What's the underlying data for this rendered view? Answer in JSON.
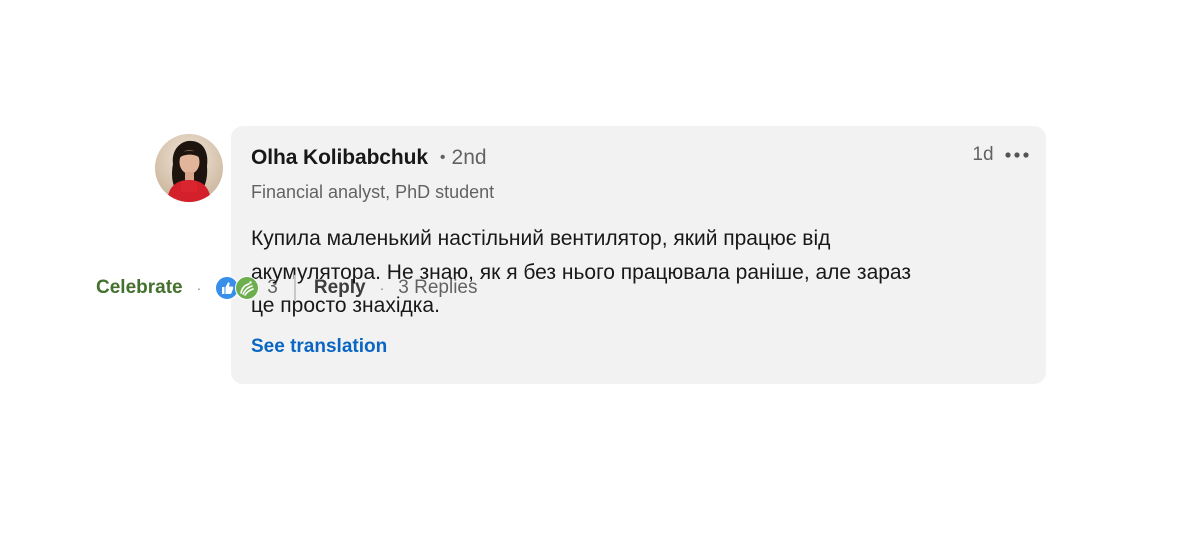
{
  "comment": {
    "author": {
      "name": "Olha Kolibabchuk",
      "degree_separator": "•",
      "degree": "2nd",
      "headline": "Financial analyst, PhD student"
    },
    "timestamp": "1d",
    "text": "Купила маленький настільний вентилятор, який працює від\nакумулятора. Не знаю, як я без нього працювала раніше, але зараз\nце просто знахідка.",
    "see_translation_label": "See translation"
  },
  "actions": {
    "celebrate_label": "Celebrate",
    "separator": "·",
    "reaction_icons": [
      "like-icon",
      "celebrate-icon"
    ],
    "reaction_count": "3",
    "reply_label": "Reply",
    "replies_label": "3 Replies"
  },
  "colors": {
    "bubble_bg": "#f2f2f2",
    "link_blue": "#0a66c2",
    "celebrate_green": "#44712e"
  }
}
